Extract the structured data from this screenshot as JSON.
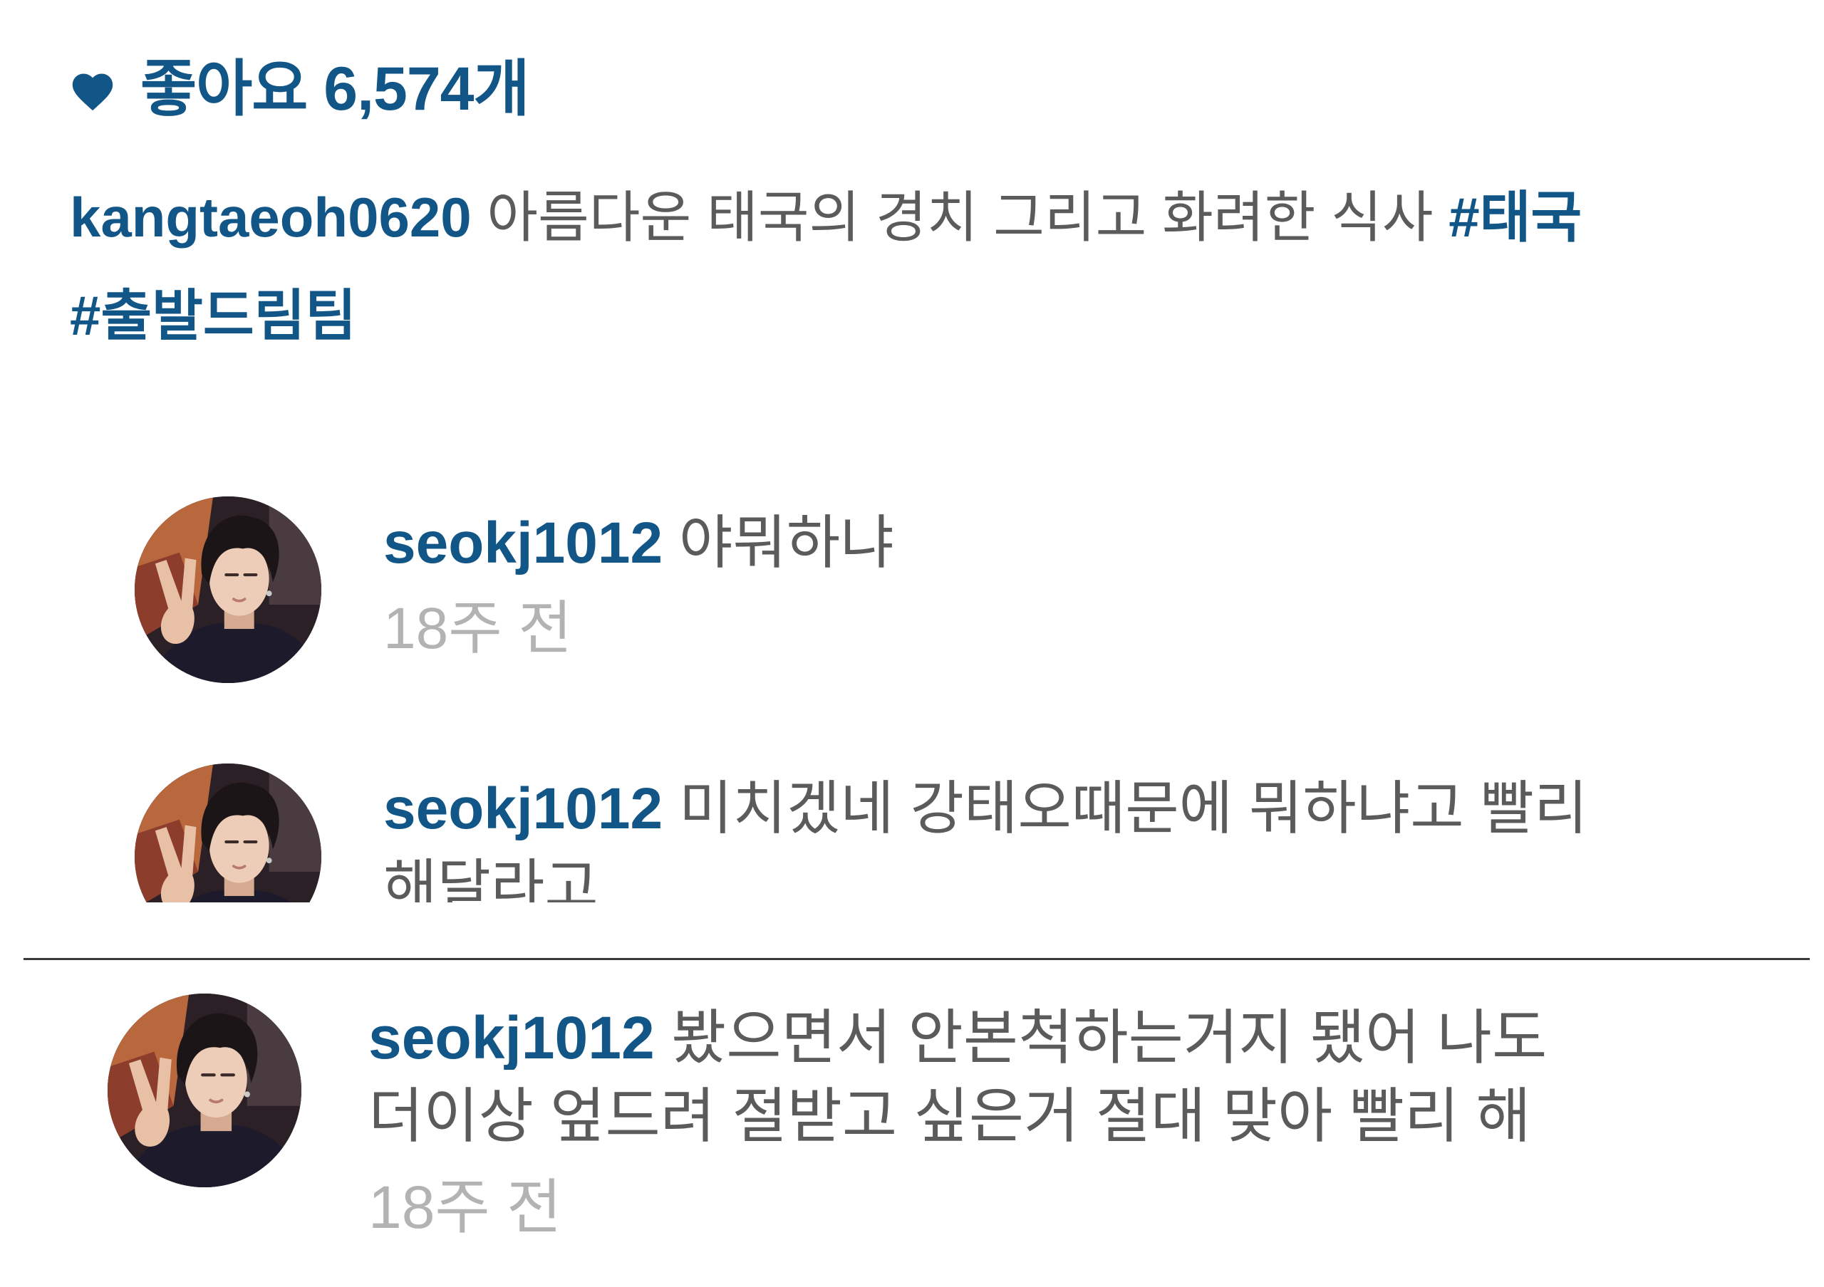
{
  "likes": {
    "icon": "heart-icon",
    "label": "좋아요",
    "count": "6,574개"
  },
  "caption": {
    "username": "kangtaeoh0620",
    "text": "아름다운 태국의 경치 그리고 화려한 식사",
    "hashtags": [
      "#태국",
      "#출발드림팀"
    ]
  },
  "comments_top": [
    {
      "username": "seokj1012",
      "lines": [
        "야뭐하냐"
      ],
      "time": "18주 전"
    },
    {
      "username": "seokj1012",
      "lines": [
        "미치겠네 강태오때문에 뭐하냐고 빨리",
        "해달라고"
      ]
    }
  ],
  "comments_bottom": [
    {
      "username": "seokj1012",
      "lines": [
        "봤으면서 안본척하는거지 됐어 나도",
        "더이상 엎드려 절받고 싶은거 절대 맞아 빨리 해"
      ],
      "time": "18주 전"
    }
  ],
  "colors": {
    "link": "#125688",
    "text": "#5b5b5b",
    "muted": "#b3b3b3",
    "divider": "#3a3a3a"
  }
}
